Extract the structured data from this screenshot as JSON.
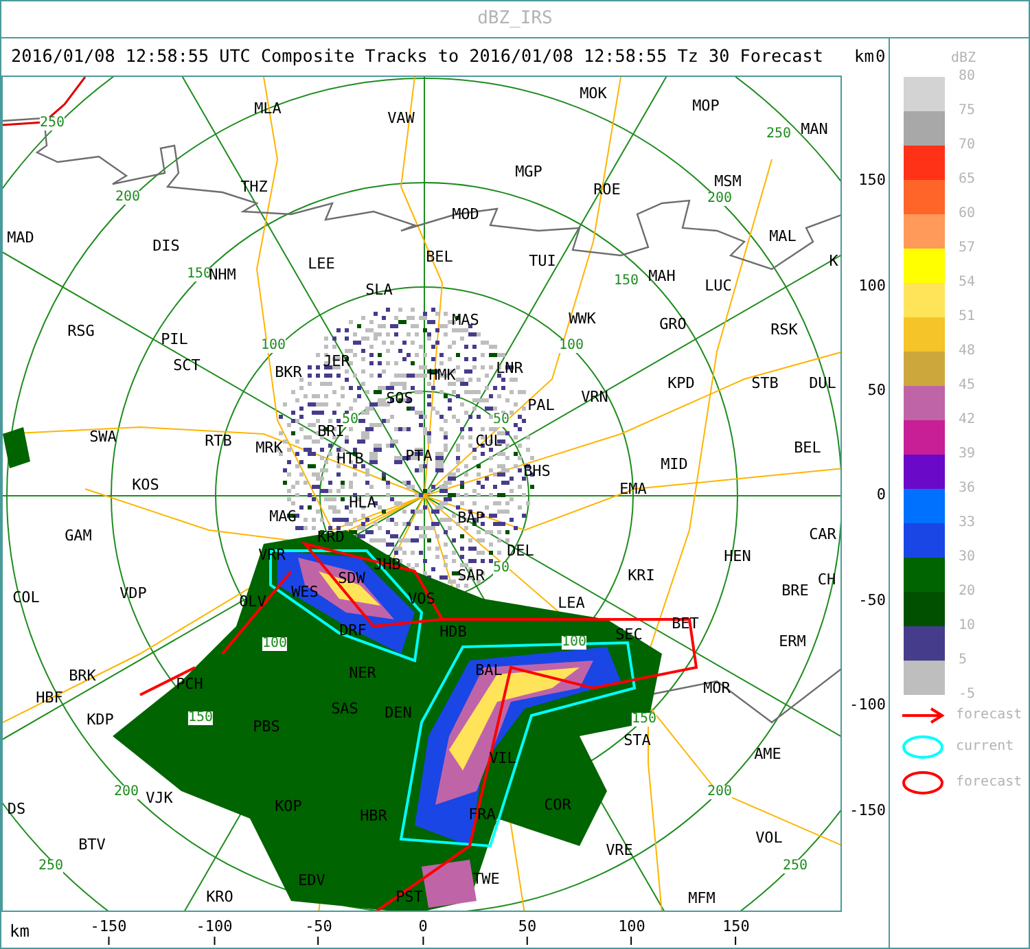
{
  "title": "dBZ_IRS",
  "header": "2016/01/08 12:58:55 UTC Composite Tracks to 2016/01/08 12:58:55 Tz 30 Forecast",
  "y_axis": {
    "unit": "km",
    "top_label": "0",
    "ticks": [
      "150",
      "100",
      "50",
      "0",
      "-50",
      "-100",
      "-150"
    ]
  },
  "x_axis": {
    "unit": "km",
    "ticks": [
      "-150",
      "-100",
      "-50",
      "0",
      "50",
      "100",
      "150"
    ]
  },
  "map": {
    "stations": [
      "MOK",
      "MLA",
      "MOP",
      "VAW",
      "MAN",
      "MGP",
      "THZ",
      "ROE",
      "MSM",
      "MOD",
      "MAD",
      "DIS",
      "MAL",
      "NHM",
      "LEE",
      "SLA",
      "BEL",
      "TUI",
      "MAH",
      "LUC",
      "K",
      "RSG",
      "PIL",
      "MAS",
      "WWK",
      "GRO",
      "RSK",
      "SCT",
      "BKR",
      "JER",
      "HMK",
      "LNR",
      "KPD",
      "STB",
      "DUL",
      "SOS",
      "PAL",
      "VRN",
      "SWA",
      "RTB",
      "MRK",
      "BRI",
      "CUL",
      "BEL",
      "HTB",
      "PTA",
      "BHS",
      "MID",
      "KOS",
      "EMA",
      "HLA",
      "MAG",
      "BAP",
      "GAM",
      "KRD",
      "CAR",
      "VRR",
      "DEL",
      "HEN",
      "JHB",
      "SDW",
      "SAR",
      "KRI",
      "CH",
      "COL",
      "VDP",
      "OLV",
      "WES",
      "VOS",
      "LEA",
      "BRE",
      "DRF",
      "HDB",
      "SEC",
      "BET",
      "ERM",
      "BRK",
      "NER",
      "BAL",
      "PCH",
      "MOR",
      "HBF",
      "KDP",
      "PBS",
      "SAS",
      "DEN",
      "STA",
      "VIL",
      "AME",
      "DS",
      "VJK",
      "KOP",
      "HBR",
      "FRA",
      "COR",
      "BTV",
      "VRE",
      "VOL",
      "EDV",
      "TWE",
      "KRO",
      "PST",
      "MFM"
    ],
    "ring_labels": [
      "250",
      "250",
      "200",
      "200",
      "150",
      "150",
      "100",
      "100",
      "50",
      "50",
      "50",
      "100",
      "100",
      "150",
      "150",
      "200",
      "200",
      "250",
      "250"
    ]
  },
  "legend": {
    "title": "dBZ",
    "swatches": [
      {
        "label": "80",
        "color": "#d3d3d3"
      },
      {
        "label": "75",
        "color": "#a8a8a8"
      },
      {
        "label": "70",
        "color": "#ff3218"
      },
      {
        "label": "65",
        "color": "#ff6428"
      },
      {
        "label": "60",
        "color": "#ff9a5a"
      },
      {
        "label": "57",
        "color": "#ffff00"
      },
      {
        "label": "54",
        "color": "#ffe45a"
      },
      {
        "label": "51",
        "color": "#f4c428"
      },
      {
        "label": "48",
        "color": "#cca83c"
      },
      {
        "label": "45",
        "color": "#c064a8"
      },
      {
        "label": "42",
        "color": "#c81e96"
      },
      {
        "label": "39",
        "color": "#6a0ac8"
      },
      {
        "label": "36",
        "color": "#0070ff"
      },
      {
        "label": "33",
        "color": "#1a46e6"
      },
      {
        "label": "30",
        "color": "#006400"
      },
      {
        "label": "20",
        "color": "#005000"
      },
      {
        "label": "10",
        "color": "#463c8c"
      },
      {
        "label": "5",
        "color": "#bebebe"
      }
    ],
    "bottom_label": "-5",
    "key": [
      {
        "kind": "arrow",
        "color": "#ff0000",
        "label": "forecast"
      },
      {
        "kind": "outline",
        "color": "#00ffff",
        "label": "current"
      },
      {
        "kind": "outline",
        "color": "#ff0000",
        "label": "forecast"
      }
    ]
  }
}
